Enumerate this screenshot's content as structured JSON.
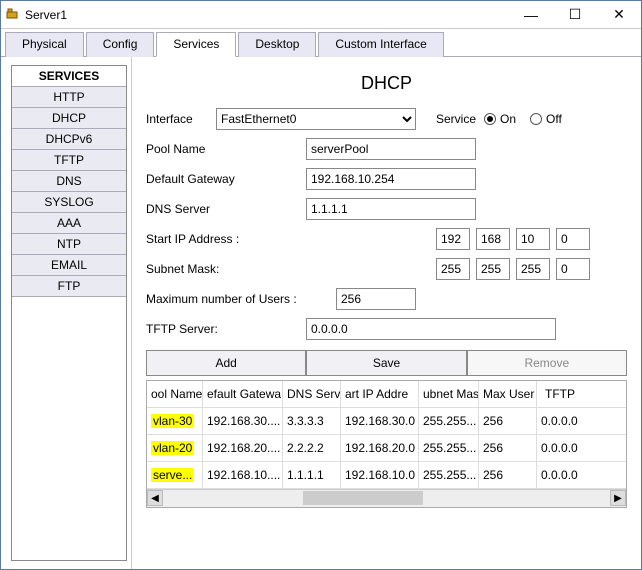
{
  "window": {
    "title": "Server1"
  },
  "winbtns": {
    "min": "—",
    "max": "☐",
    "close": "✕"
  },
  "tabs": [
    "Physical",
    "Config",
    "Services",
    "Desktop",
    "Custom Interface"
  ],
  "active_tab": 2,
  "sidebar": {
    "header": "SERVICES",
    "items": [
      "HTTP",
      "DHCP",
      "DHCPv6",
      "TFTP",
      "DNS",
      "SYSLOG",
      "AAA",
      "NTP",
      "EMAIL",
      "FTP"
    ]
  },
  "page": {
    "title": "DHCP",
    "interface_label": "Interface",
    "interface_value": "FastEthernet0",
    "service_label": "Service",
    "on_label": "On",
    "off_label": "Off",
    "service_on": true,
    "pool_name_label": "Pool Name",
    "pool_name_value": "serverPool",
    "gateway_label": "Default Gateway",
    "gateway_value": "192.168.10.254",
    "dns_label": "DNS Server",
    "dns_value": "1.1.1.1",
    "startip_label": "Start IP Address :",
    "startip": [
      "192",
      "168",
      "10",
      "0"
    ],
    "subnet_label": "Subnet Mask:",
    "subnet": [
      "255",
      "255",
      "255",
      "0"
    ],
    "maxusers_label": "Maximum number of Users :",
    "maxusers_value": "256",
    "tftp_label": "TFTP Server:",
    "tftp_value": "0.0.0.0",
    "add_label": "Add",
    "save_label": "Save",
    "remove_label": "Remove"
  },
  "table": {
    "headers": [
      "ool Name",
      "efault Gatewa",
      "DNS Serve",
      "art IP Addre",
      "ubnet Mas",
      "Max User",
      "TFTP"
    ],
    "rows": [
      {
        "name": "vlan-30",
        "name_hl": true,
        "gw": "192.168.30....",
        "dns": "3.3.3.3",
        "start": "192.168.30.0",
        "mask": "255.255...",
        "max": "256",
        "tftp": "0.0.0.0"
      },
      {
        "name": "vlan-20",
        "name_hl": true,
        "gw": "192.168.20....",
        "dns": "2.2.2.2",
        "start": "192.168.20.0",
        "mask": "255.255...",
        "max": "256",
        "tftp": "0.0.0.0"
      },
      {
        "name": "serve...",
        "name_hl": true,
        "gw": "192.168.10....",
        "dns": "1.1.1.1",
        "start": "192.168.10.0",
        "mask": "255.255...",
        "max": "256",
        "tftp": "0.0.0.0"
      }
    ]
  }
}
